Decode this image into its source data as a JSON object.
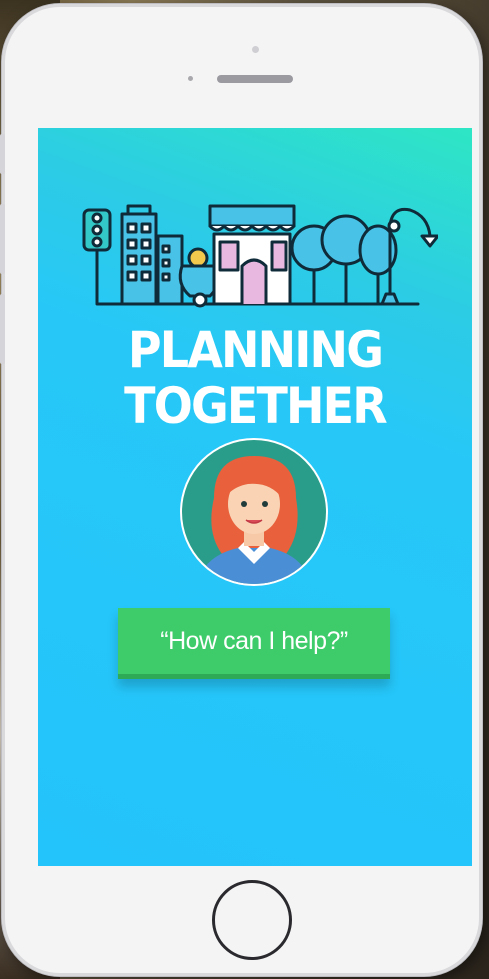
{
  "screen": {
    "title_line1": "PLANNING",
    "title_line2": "TOGETHER",
    "help_button_label": "“How can I help?”"
  },
  "colors": {
    "gradient_top": "#2ee6c4",
    "screen_blue": "#23c4fb",
    "button_green": "#3ecc6a",
    "phone_body": "#f4f4f5"
  },
  "icons": {
    "illustration": "city-skyline-illustration",
    "avatar": "woman-avatar-icon"
  }
}
